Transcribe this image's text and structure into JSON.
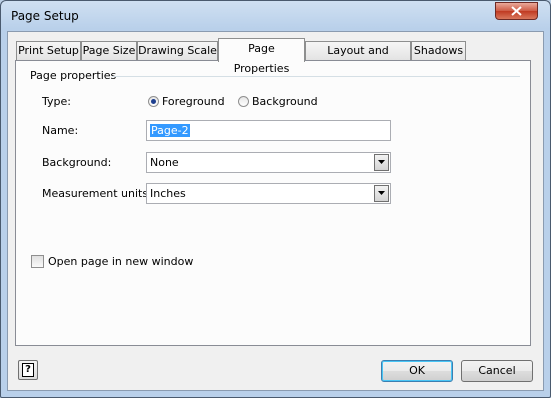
{
  "window": {
    "title": "Page Setup"
  },
  "tabs": [
    {
      "label": "Print Setup"
    },
    {
      "label": "Page Size"
    },
    {
      "label": "Drawing Scale"
    },
    {
      "label": "Page Properties",
      "active": true
    },
    {
      "label": "Layout and Routing"
    },
    {
      "label": "Shadows"
    }
  ],
  "page_properties": {
    "group_label": "Page properties",
    "type": {
      "label": "Type:",
      "options": [
        "Foreground",
        "Background"
      ],
      "selected": "Foreground"
    },
    "name": {
      "label": "Name:",
      "value": "Page-2"
    },
    "background": {
      "label": "Background:",
      "value": "None"
    },
    "measurement_units": {
      "label": "Measurement units:",
      "value": "Inches"
    },
    "open_in_new_window": {
      "label": "Open page in new window",
      "checked": false
    }
  },
  "buttons": {
    "help": "?",
    "ok": "OK",
    "cancel": "Cancel"
  },
  "colors": {
    "selection": "#3399ff",
    "radio_dot": "#1e3f8f",
    "close_button": "#c03a22"
  }
}
